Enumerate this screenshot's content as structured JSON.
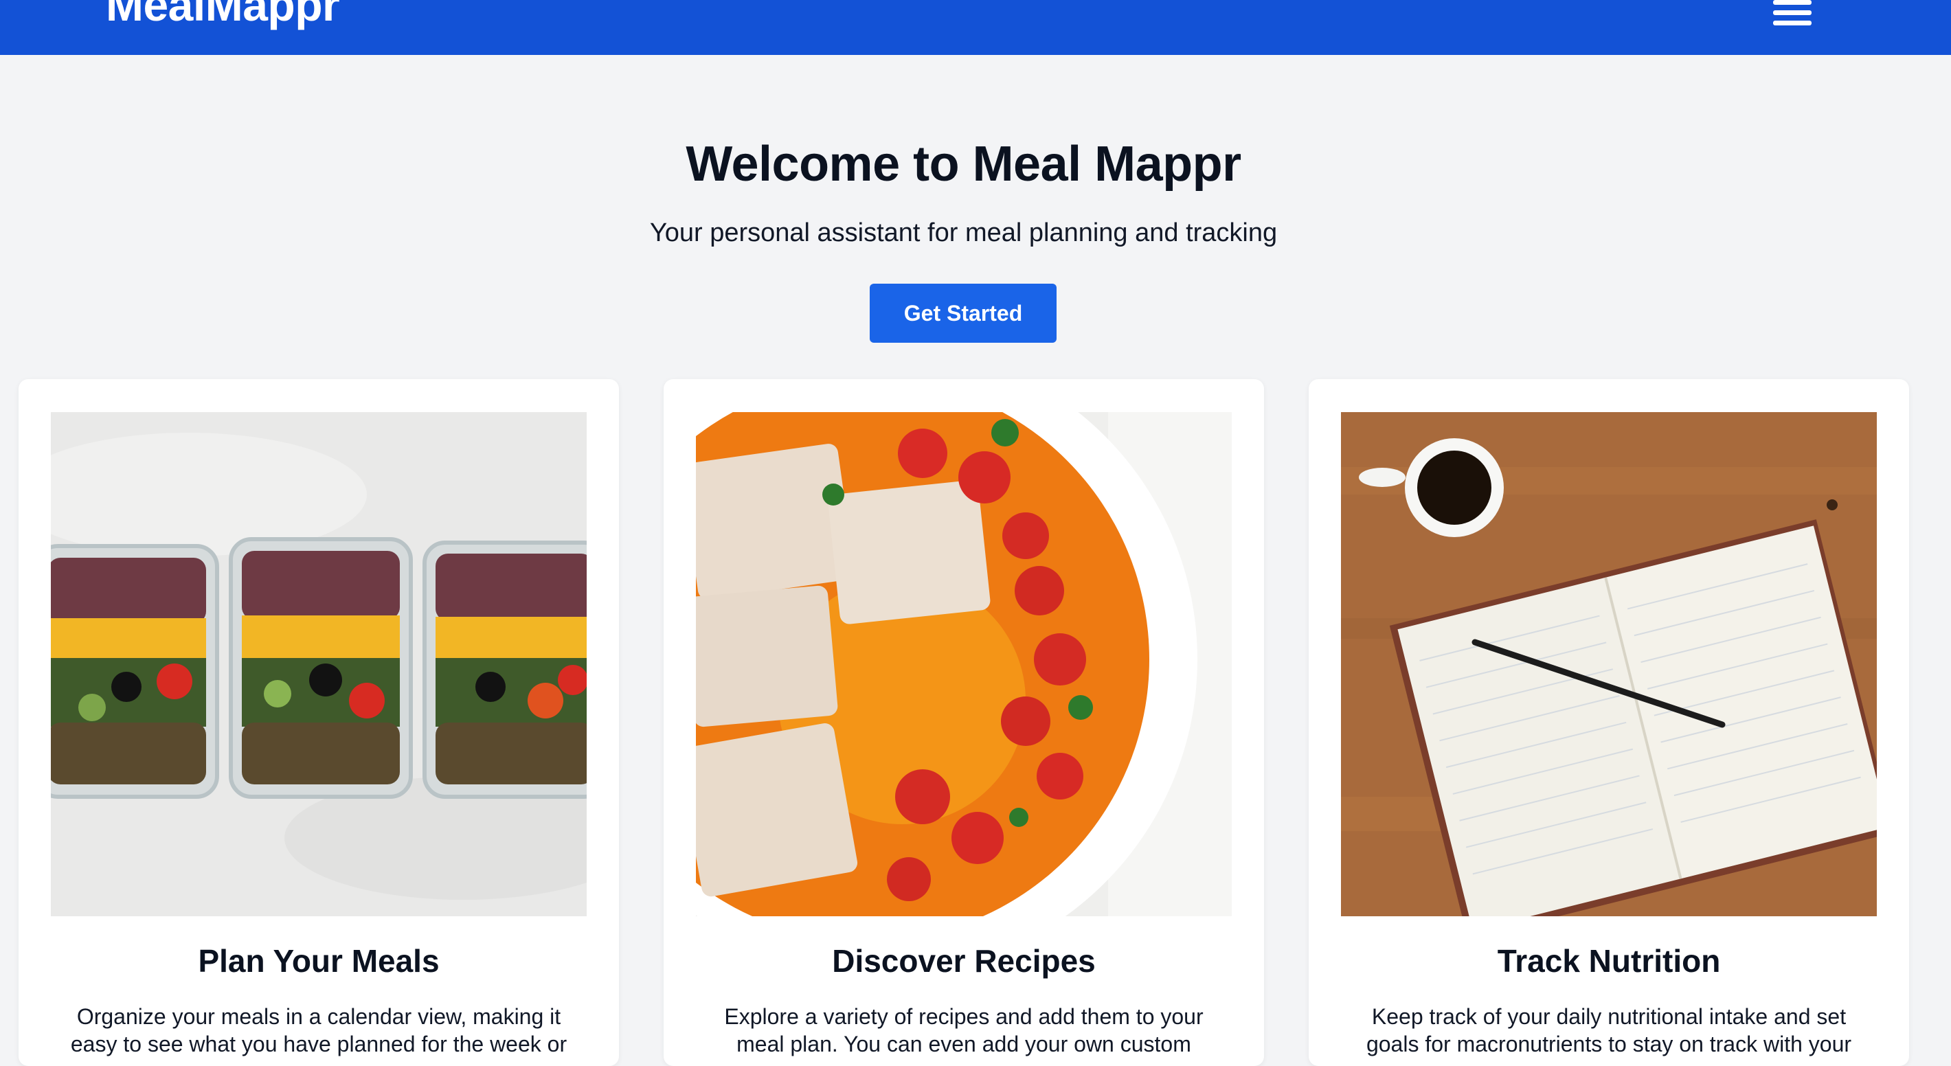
{
  "header": {
    "brand": "MealMappr",
    "menu_icon": "hamburger-menu-icon",
    "background_color": "#1352d6"
  },
  "hero": {
    "title": "Welcome to Meal Mappr",
    "subtitle": "Your personal assistant for meal planning and tracking",
    "cta_label": "Get Started",
    "cta_color": "#1a64e8"
  },
  "features": [
    {
      "title": "Plan Your Meals",
      "description": "Organize your meals in a calendar view, making it easy to see what you have planned for the week or",
      "image": "meal-prep-containers-image"
    },
    {
      "title": "Discover Recipes",
      "description": "Explore a variety of recipes and add them to your meal plan. You can even add your own custom",
      "image": "fish-tomato-dish-image"
    },
    {
      "title": "Track Nutrition",
      "description": "Keep track of your daily nutritional intake and set goals for macronutrients to stay on track with your",
      "image": "notebook-coffee-image"
    }
  ]
}
